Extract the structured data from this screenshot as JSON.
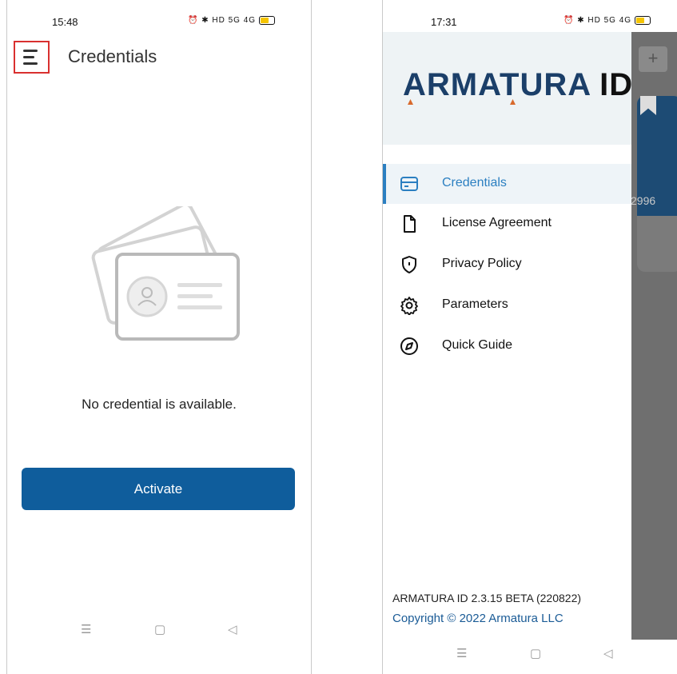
{
  "left_screen": {
    "status_bar": {
      "time": "15:48",
      "icons": "⏰ ✱ HD 5G 4G"
    },
    "header": {
      "title": "Credentials"
    },
    "empty_state": {
      "message": "No credential is available."
    },
    "activate_button": {
      "label": "Activate"
    },
    "nav_bar": {
      "menu": "☰",
      "home": "▢",
      "back": "◁"
    }
  },
  "right_screen": {
    "status_bar": {
      "time": "17:31",
      "icons": "⏰ ✱ HD 5G 4G"
    },
    "background": {
      "add_button": "+",
      "card_number_fragment": "2996"
    },
    "drawer": {
      "logo": {
        "word": "ARMATURA",
        "suffix": "ID"
      },
      "items": [
        {
          "label": "Credentials",
          "icon": "credit-card-icon",
          "active": true
        },
        {
          "label": "License Agreement",
          "icon": "document-icon",
          "active": false
        },
        {
          "label": "Privacy Policy",
          "icon": "shield-icon",
          "active": false
        },
        {
          "label": "Parameters",
          "icon": "gear-icon",
          "active": false
        },
        {
          "label": "Quick Guide",
          "icon": "compass-icon",
          "active": false
        }
      ],
      "version": "ARMATURA ID 2.3.15 BETA (220822)",
      "copyright": "Copyright © 2022 Armatura LLC"
    },
    "nav_bar": {
      "menu": "☰",
      "home": "▢",
      "back": "◁"
    }
  },
  "colors": {
    "primary": "#0f5d9c",
    "accent": "#2b7fc1",
    "highlight_box": "#d9302f",
    "logo_text": "#1b3f69",
    "logo_accent": "#d8692c"
  }
}
